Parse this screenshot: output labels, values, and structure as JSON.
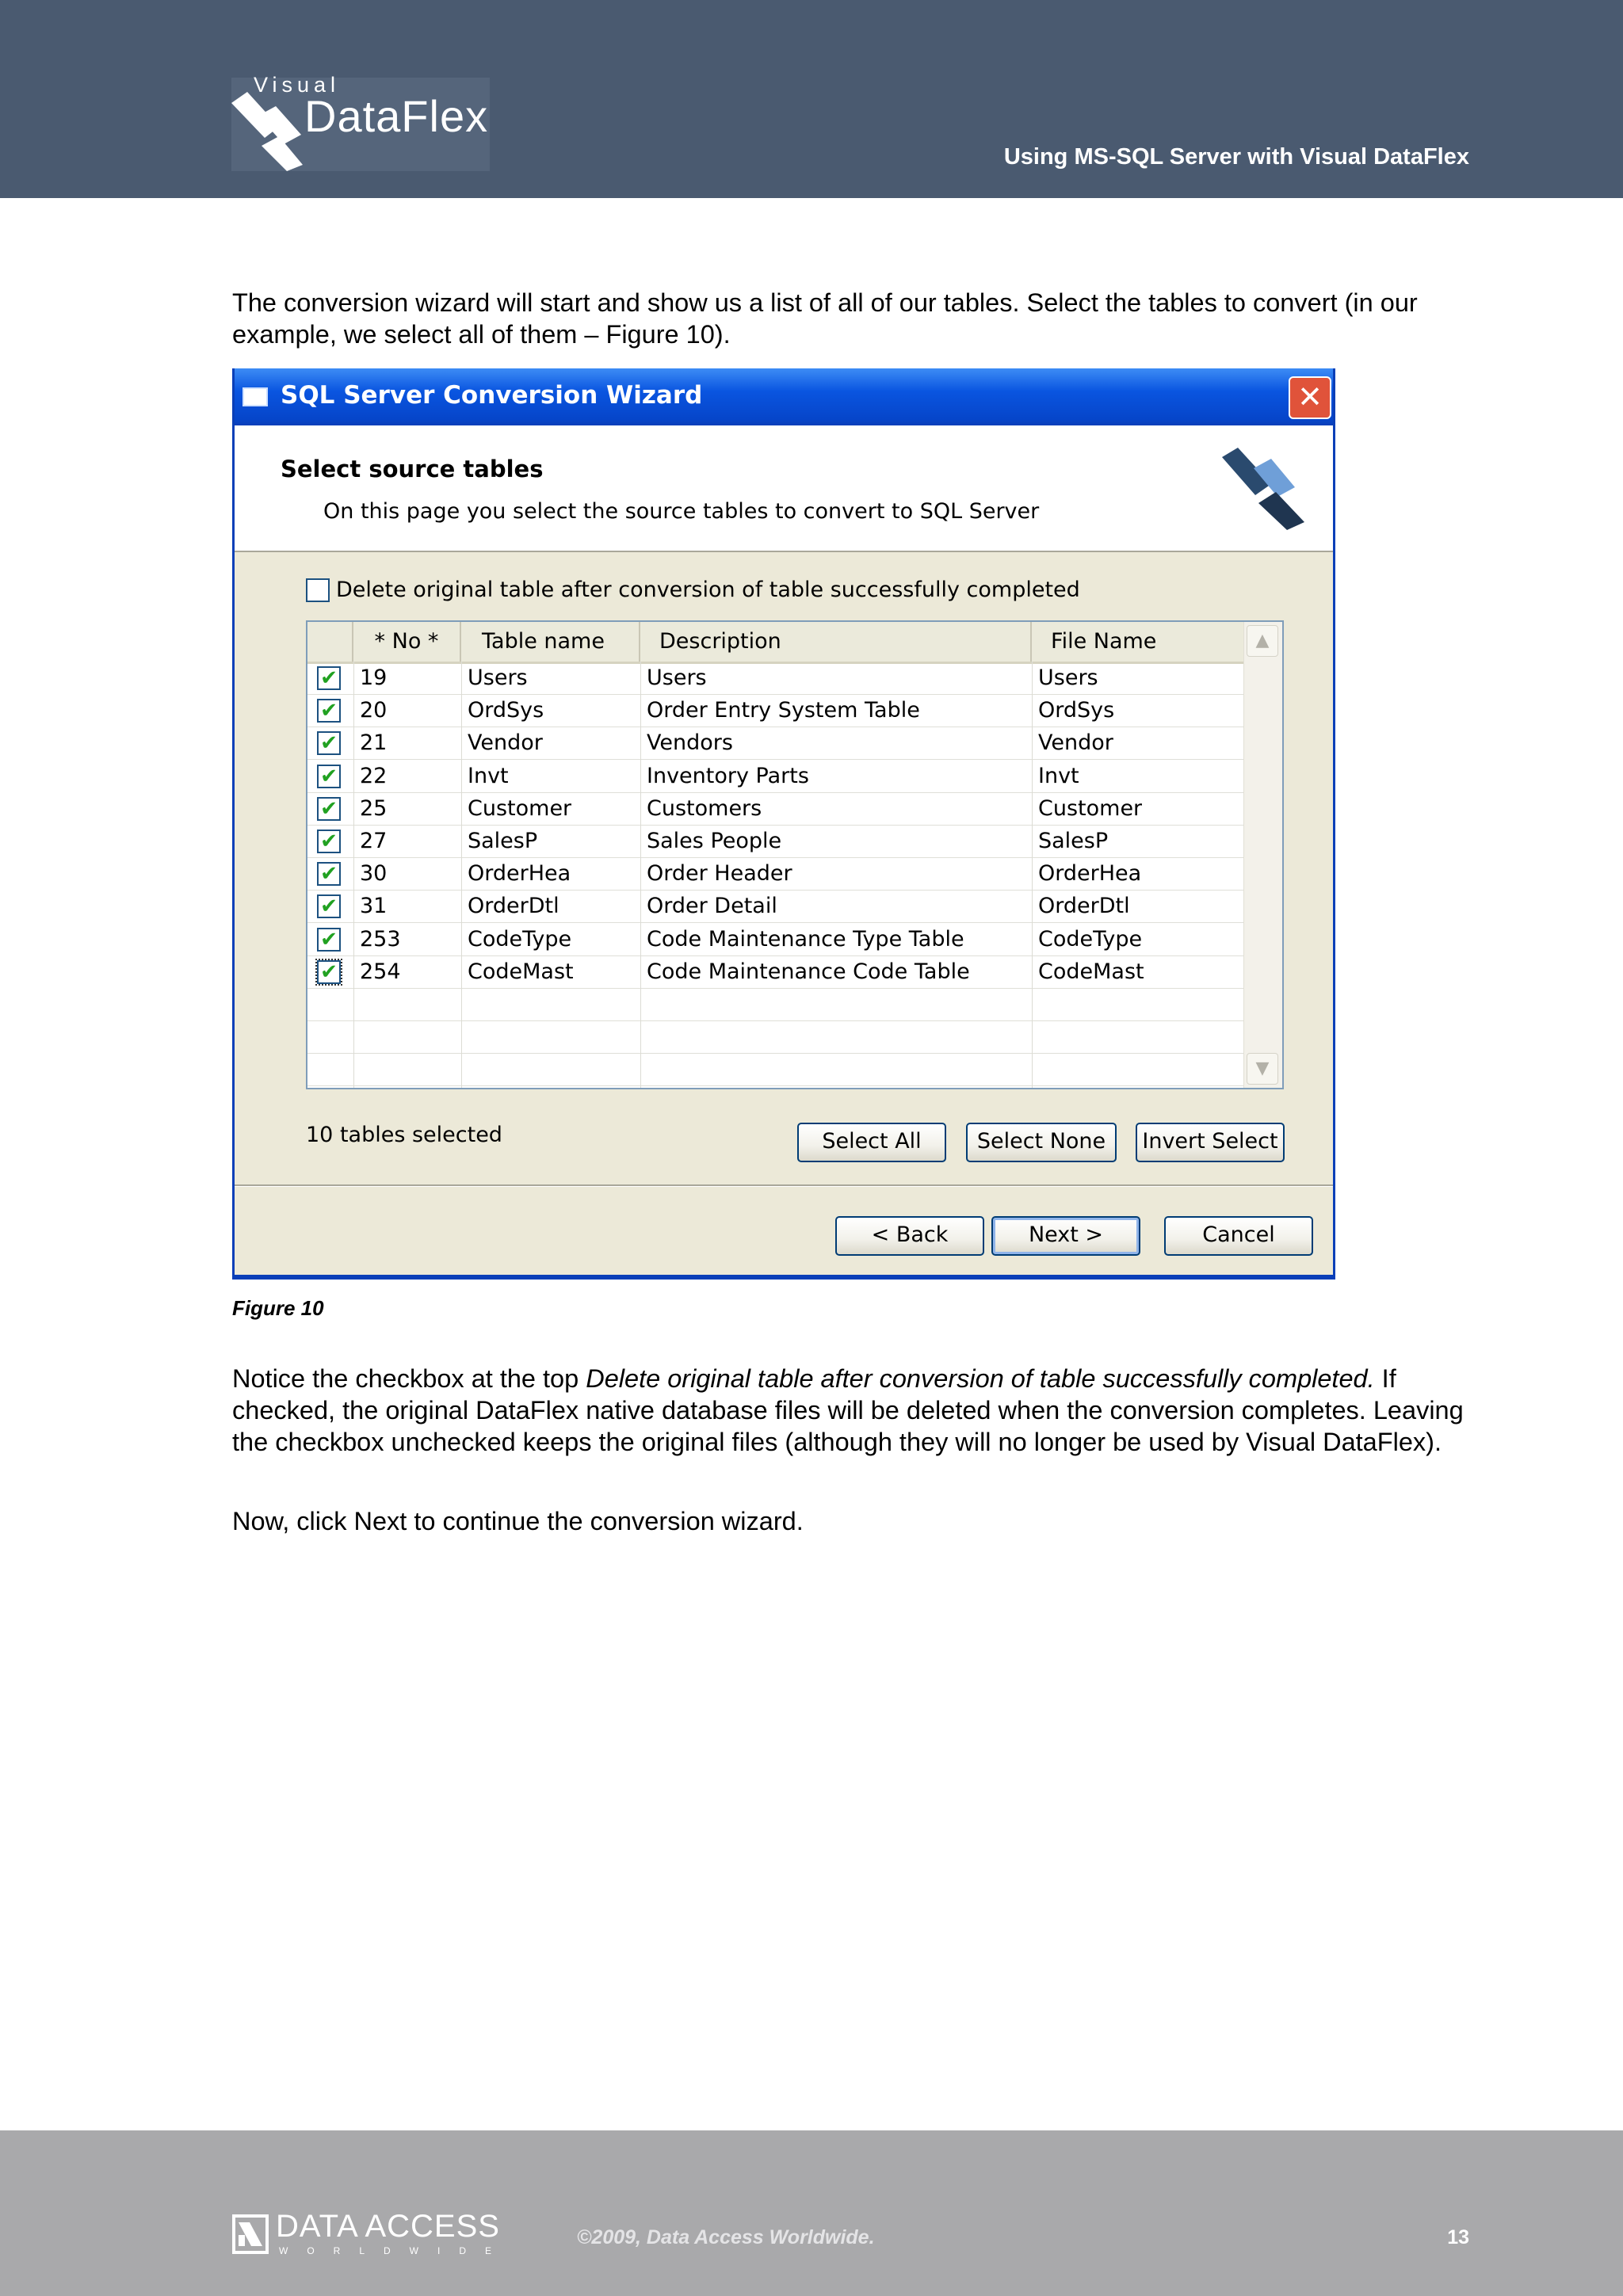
{
  "header": {
    "logo_small": "Visual",
    "logo_main": "DataFlex",
    "title": "Using MS-SQL Server with Visual DataFlex"
  },
  "body": {
    "intro": "The conversion wizard will start and show us a list of all of our tables. Select the tables to convert (in our example, we select all of them – Figure 10).",
    "figure_caption": "Figure 10",
    "notice_prefix": "Notice the checkbox at the top ",
    "notice_italic": "Delete original table after conversion of table successfully completed.",
    "notice_suffix": " If checked, the original DataFlex native database files will be deleted when the conversion completes. Leaving the checkbox unchecked keeps the original files (although they will no longer be used by Visual DataFlex).",
    "next_instruction": "Now, click Next to continue the conversion wizard."
  },
  "wizard": {
    "window_title": "SQL Server Conversion Wizard",
    "close_glyph": "✕",
    "page_title": "Select source tables",
    "page_subtitle": "On this page you select the source tables to convert to SQL Server",
    "delete_checkbox_label": "Delete original table after conversion of table successfully completed",
    "delete_checked": false,
    "columns": [
      "* No *",
      "Table name",
      "Description",
      "File Name"
    ],
    "rows": [
      {
        "no": "19",
        "table": "Users",
        "description": "Users",
        "file": "Users"
      },
      {
        "no": "20",
        "table": "OrdSys",
        "description": "Order Entry System Table",
        "file": "OrdSys"
      },
      {
        "no": "21",
        "table": "Vendor",
        "description": "Vendors",
        "file": "Vendor"
      },
      {
        "no": "22",
        "table": "Invt",
        "description": "Inventory Parts",
        "file": "Invt"
      },
      {
        "no": "25",
        "table": "Customer",
        "description": "Customers",
        "file": "Customer"
      },
      {
        "no": "27",
        "table": "SalesP",
        "description": "Sales People",
        "file": "SalesP"
      },
      {
        "no": "30",
        "table": "OrderHea",
        "description": "Order Header",
        "file": "OrderHea"
      },
      {
        "no": "31",
        "table": "OrderDtl",
        "description": "Order Detail",
        "file": "OrderDtl"
      },
      {
        "no": "253",
        "table": "CodeType",
        "description": "Code Maintenance Type Table",
        "file": "CodeType"
      },
      {
        "no": "254",
        "table": "CodeMast",
        "description": "Code Maintenance Code Table",
        "file": "CodeMast"
      }
    ],
    "check_glyph": "✔",
    "status": "10 tables selected",
    "buttons": {
      "select_all": "Select All",
      "select_none": "Select None",
      "invert_select": "Invert Select",
      "back": "< Back",
      "next": "Next >",
      "cancel": "Cancel"
    },
    "scroll_up": "▲",
    "scroll_down": "▼"
  },
  "footer": {
    "logo_main": "DATA ACCESS",
    "logo_sub": "WORLDWIDE",
    "copyright": "©2009, Data Access Worldwide.",
    "page_number": "13"
  },
  "colors": {
    "header_band": "#4a5a70",
    "footer_band": "#a9a9ab",
    "xp_titlebar": "#0a55e0",
    "dialog_bg": "#ece9d8",
    "check_green": "#21a121"
  }
}
